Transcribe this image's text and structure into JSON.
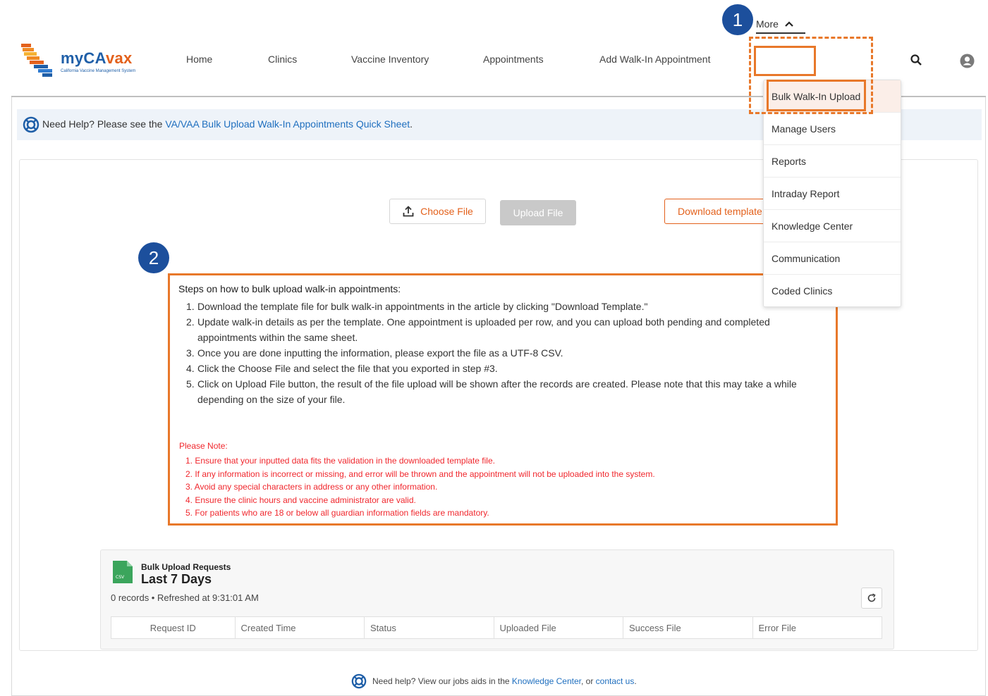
{
  "brand": {
    "name_part1": "my",
    "name_part2": "CA",
    "name_part3": "vax",
    "subtitle": "California Vaccine Management System",
    "colors": {
      "primary": "#1f5fa8",
      "accent": "#e3611c"
    }
  },
  "nav": {
    "items": [
      "Home",
      "Clinics",
      "Vaccine Inventory",
      "Appointments",
      "Add Walk-In Appointment"
    ],
    "more_label": "More"
  },
  "header_icons": {
    "search": "search-icon",
    "user": "user-icon"
  },
  "more_menu": {
    "items": [
      "Bulk Walk-In Upload",
      "Manage Users",
      "Reports",
      "Intraday Report",
      "Knowledge Center",
      "Communication",
      "Coded Clinics"
    ]
  },
  "help": {
    "prefix": "Need Help? Please see the ",
    "link": "VA/VAA Bulk Upload Walk-In Appointments Quick Sheet",
    "suffix": "."
  },
  "actions": {
    "choose_file": "Choose File",
    "upload_file": "Upload File",
    "download_template": "Download template"
  },
  "badges": {
    "first": "1",
    "second": "2"
  },
  "steps": {
    "title": "Steps on how to bulk upload walk-in appointments:",
    "items": [
      {
        "n": "1.",
        "text": "Download the template file for bulk walk-in appointments in the article by clicking \"Download Template.\""
      },
      {
        "n": "2.",
        "text": "Update walk-in details as per the template. One appointment is uploaded per row, and you can upload both pending and completed appointments within the same sheet."
      },
      {
        "n": "3.",
        "text": "Once you are done inputting the information, please export the file as a UTF-8 CSV."
      },
      {
        "n": "4.",
        "text": "Click the Choose File and select the file that you exported in step #3."
      },
      {
        "n": "5.",
        "text": "Click on Upload File button, the result of the file upload will be shown after the records are created. Please note that this may take a while depending on the size of your file."
      }
    ]
  },
  "notes": {
    "title": "Please Note:",
    "items": [
      "1. Ensure that your inputted data fits the validation in the downloaded template file.",
      "2. If any information is incorrect or missing, and error will be thrown and the appointment will not be uploaded into the system.",
      "3. Avoid any special characters in address or any other information.",
      "4. Ensure the clinic hours and vaccine administrator are valid.",
      "5. For patients who are 18 or below all guardian information fields are mandatory."
    ]
  },
  "requests_panel": {
    "icon_label": "CSV",
    "title": "Bulk Upload Requests",
    "subtitle": "Last 7 Days",
    "meta": "0 records • Refreshed at 9:31:01 AM",
    "columns": [
      "Request ID",
      "Created Time",
      "Status",
      "Uploaded File",
      "Success File",
      "Error File"
    ]
  },
  "footer": {
    "prefix": "Need help? View our jobs aids in the ",
    "link1": "Knowledge Center",
    "middle": ", or ",
    "link2": "contact us",
    "suffix": "."
  }
}
